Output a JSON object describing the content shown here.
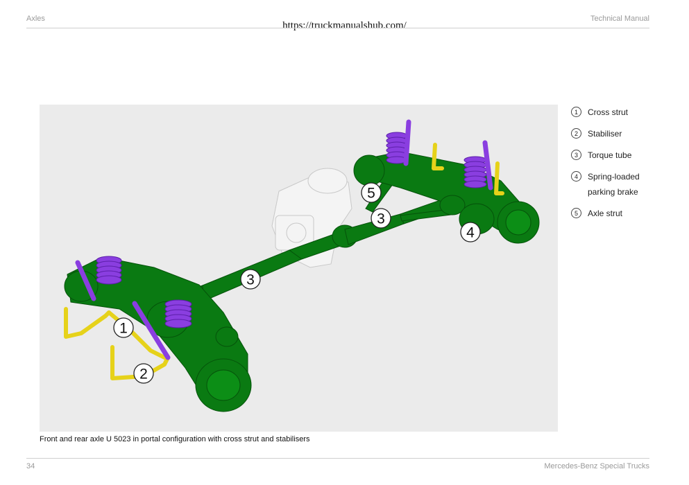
{
  "header": {
    "section": "Axles",
    "manual": "Technical Manual",
    "url": "https://truckmanualshub.com/"
  },
  "figure": {
    "callouts": [
      {
        "label": "1"
      },
      {
        "label": "2"
      },
      {
        "label": "3"
      },
      {
        "label": "3"
      },
      {
        "label": "4"
      },
      {
        "label": "5"
      }
    ]
  },
  "legend": {
    "items": [
      {
        "num": "1",
        "text": "Cross strut"
      },
      {
        "num": "2",
        "text": "Stabiliser"
      },
      {
        "num": "3",
        "text": "Torque tube"
      },
      {
        "num": "4",
        "text": "Spring-loaded parking brake"
      },
      {
        "num": "5",
        "text": "Axle strut"
      }
    ]
  },
  "caption": "Front and rear axle U 5023 in portal configuration with cross strut and stabilisers",
  "footer": {
    "page": "34",
    "brand": "Mercedes-Benz Special Trucks"
  },
  "colors": {
    "axle_green": "#0a7a12",
    "spring_purple": "#8a3ee0",
    "stabiliser_yellow": "#e6d21a",
    "gearbox_white": "#f3f3f3"
  }
}
